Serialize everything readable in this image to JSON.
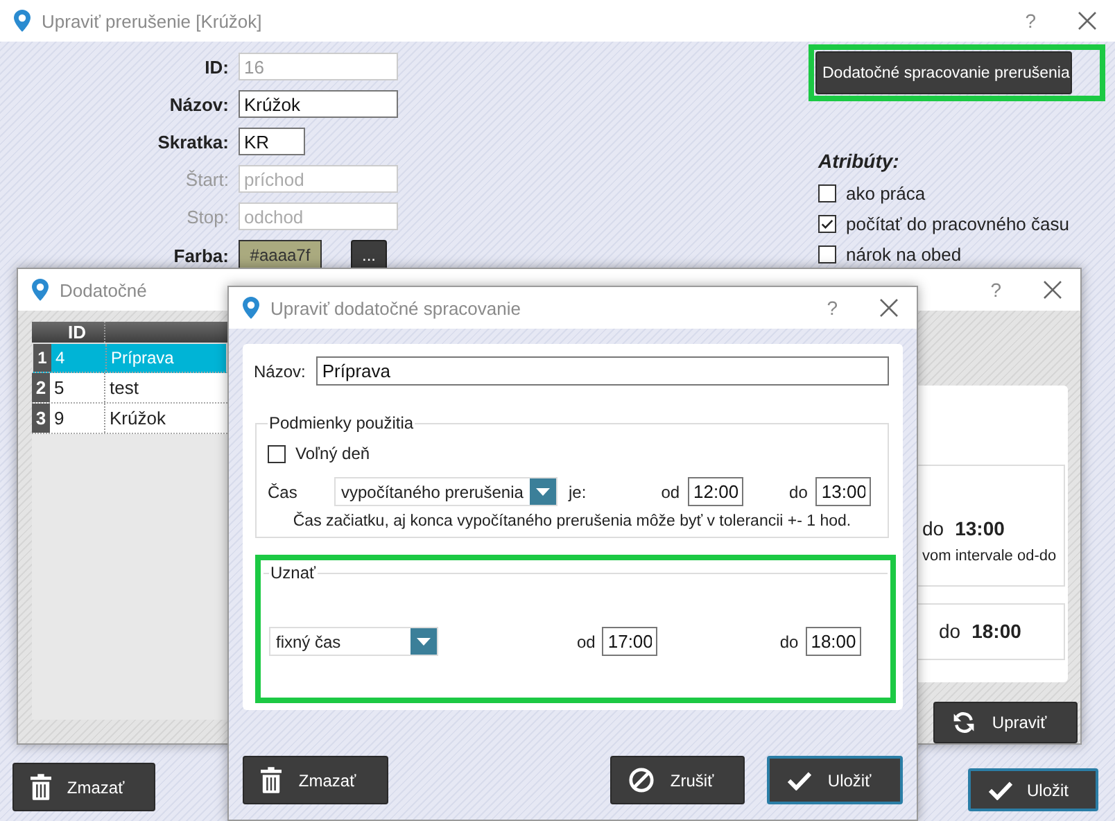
{
  "main_window": {
    "title": "Upraviť prerušenie [Krúžok]",
    "help": "?",
    "fields": [
      {
        "label": "ID:",
        "value": "16",
        "readonly": true,
        "disabled": false
      },
      {
        "label": "Názov:",
        "value": "Krúžok",
        "readonly": false,
        "disabled": false
      },
      {
        "label": "Skratka:",
        "value": "KR",
        "readonly": false,
        "disabled": false
      },
      {
        "label": "Štart:",
        "placeholder": "príchod",
        "readonly": false,
        "disabled": true
      },
      {
        "label": "Stop:",
        "placeholder": "odchod",
        "readonly": false,
        "disabled": true
      }
    ],
    "color_field": {
      "label": "Farba:",
      "value": "#aaaa7f",
      "color": "#aaaa7f",
      "button": "..."
    },
    "extra_button": {
      "label": "Dodatočné spracovanie prerušenia",
      "highlighted": true
    },
    "attributes": {
      "title": "Atribúty:",
      "items": [
        {
          "label": "ako práca",
          "checked": false
        },
        {
          "label": "počítať do pracovného času",
          "checked": true
        },
        {
          "label": "nárok na obed",
          "checked": false
        }
      ]
    },
    "buttons": [
      {
        "label": "Zmazať",
        "kind": "delete",
        "primary": false
      },
      {
        "label": "Uložit",
        "kind": "save",
        "primary": true
      }
    ]
  },
  "list_window": {
    "title": "Dodatočné",
    "help": "?",
    "table": {
      "columns": [
        "ID"
      ],
      "rows": [
        {
          "number": "1",
          "id": "4",
          "name": "Príprava",
          "selected": true
        },
        {
          "number": "2",
          "id": "5",
          "name": "test",
          "selected": false
        },
        {
          "number": "3",
          "id": "9",
          "name": "Krúžok",
          "selected": false
        }
      ]
    },
    "detail": [
      {
        "label": "do",
        "time": "13:00",
        "note": "vom intervale od-do"
      },
      {
        "label": "do",
        "time": "18:00"
      }
    ],
    "button": {
      "label": "Upraviť",
      "kind": "edit",
      "primary": false
    }
  },
  "edit_window": {
    "title": "Upraviť dodatočné spracovanie",
    "help": "?",
    "name": {
      "label": "Názov:",
      "value": "Príprava"
    },
    "conditions": {
      "title": "Podmienky použitia",
      "free_day": {
        "label": "Voľný deň",
        "checked": false
      },
      "time": {
        "label": "Čas",
        "select": "vypočítaného prerušenia",
        "is": "je:",
        "from_label": "od",
        "from": "12:00",
        "to_label": "do",
        "to": "13:00"
      },
      "hint": "Čas začiatku, aj konca vypočítaného prerušenia môže byť v tolerancii +- 1 hod."
    },
    "recognize": {
      "title": "Uznať",
      "highlighted": true,
      "select": "fixný čas",
      "from_label": "od",
      "from": "17:00",
      "to_label": "do",
      "to": "18:00"
    },
    "buttons": [
      {
        "label": "Zmazať",
        "kind": "delete",
        "primary": false
      },
      {
        "label": "Zrušiť",
        "kind": "cancel",
        "primary": false
      },
      {
        "label": "Uložiť",
        "kind": "save",
        "primary": true
      }
    ]
  }
}
